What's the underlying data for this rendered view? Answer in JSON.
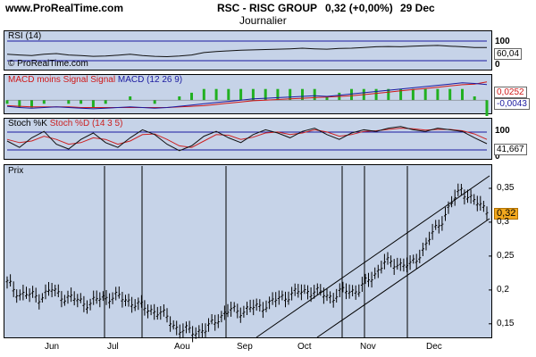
{
  "header": {
    "site": "www.ProRealTime.com",
    "title": "RSC - RISC GROUP",
    "quote": "0,32 (+0,00%)",
    "date": "29 Dec",
    "period": "Journalier"
  },
  "panels": {
    "rsi": {
      "label": "RSI (14)",
      "watermark": "© ProRealTime.com",
      "scale_top": "100",
      "scale_bottom": "0",
      "last_tag": "60,04"
    },
    "macd": {
      "label_a": "MACD moins Signal",
      "label_b": "Signal",
      "label_c": "MACD (12 26 9)",
      "tag_pos": "0,0252",
      "tag_neg": "-0,0043"
    },
    "stoch": {
      "label_a": "Stoch %K",
      "label_b": "Stoch %D (14 3 5)",
      "scale_top": "100",
      "scale_bottom": "0",
      "last_tag": "41,667"
    },
    "price": {
      "label": "Prix",
      "last_tag": "0,32"
    }
  },
  "colors": {
    "panel_bg": "#c6d3e8",
    "macd_red": "#d01818",
    "macd_blue": "#1a1aa0",
    "hist_green": "#21b021",
    "stoch_red": "#cc2222",
    "price_tag": "#f2a81e"
  },
  "chart_data": {
    "type": "line",
    "x_ticks": [
      "Jun",
      "Jul",
      "Aou",
      "Sep",
      "Oct",
      "Nov",
      "Dec"
    ],
    "y_ticks": [
      "0,35",
      "0,3",
      "0,25",
      "0,2",
      "0,15"
    ],
    "ylim": [
      0.13,
      0.375
    ],
    "x_range_days": 150,
    "price_path": [
      [
        0,
        0.21
      ],
      [
        4,
        0.195
      ],
      [
        10,
        0.19
      ],
      [
        14,
        0.2
      ],
      [
        18,
        0.19
      ],
      [
        22,
        0.185
      ],
      [
        26,
        0.18
      ],
      [
        30,
        0.19
      ],
      [
        34,
        0.19
      ],
      [
        38,
        0.185
      ],
      [
        42,
        0.175
      ],
      [
        46,
        0.17
      ],
      [
        50,
        0.16
      ],
      [
        54,
        0.14
      ],
      [
        58,
        0.14
      ],
      [
        62,
        0.14
      ],
      [
        66,
        0.16
      ],
      [
        70,
        0.17
      ],
      [
        74,
        0.17
      ],
      [
        78,
        0.175
      ],
      [
        82,
        0.18
      ],
      [
        86,
        0.19
      ],
      [
        90,
        0.195
      ],
      [
        94,
        0.2
      ],
      [
        98,
        0.195
      ],
      [
        102,
        0.19
      ],
      [
        106,
        0.2
      ],
      [
        110,
        0.2
      ],
      [
        114,
        0.22
      ],
      [
        118,
        0.24
      ],
      [
        122,
        0.24
      ],
      [
        126,
        0.235
      ],
      [
        130,
        0.26
      ],
      [
        134,
        0.29
      ],
      [
        138,
        0.32
      ],
      [
        142,
        0.35
      ],
      [
        146,
        0.33
      ],
      [
        150,
        0.32
      ]
    ],
    "rsi": [
      40,
      38,
      36,
      40,
      42,
      38,
      36,
      34,
      35,
      37,
      40,
      36,
      34,
      33,
      35,
      38,
      45,
      48,
      50,
      52,
      53,
      54,
      55,
      56,
      58,
      56,
      55,
      57,
      58,
      60,
      62,
      63,
      62,
      64,
      65,
      66,
      64,
      62,
      60,
      60
    ],
    "macd": [
      -0.01,
      -0.012,
      -0.013,
      -0.012,
      -0.011,
      -0.012,
      -0.013,
      -0.014,
      -0.013,
      -0.012,
      -0.011,
      -0.012,
      -0.013,
      -0.012,
      -0.01,
      -0.008,
      -0.006,
      -0.004,
      -0.002,
      0.0,
      0.002,
      0.003,
      0.004,
      0.005,
      0.006,
      0.007,
      0.006,
      0.008,
      0.01,
      0.012,
      0.014,
      0.016,
      0.018,
      0.02,
      0.022,
      0.024,
      0.026,
      0.028,
      0.027,
      0.0252
    ],
    "macd_signal": [
      -0.009,
      -0.01,
      -0.011,
      -0.011,
      -0.011,
      -0.011,
      -0.012,
      -0.012,
      -0.012,
      -0.012,
      -0.012,
      -0.012,
      -0.012,
      -0.012,
      -0.011,
      -0.01,
      -0.009,
      -0.007,
      -0.005,
      -0.003,
      -0.001,
      0.0,
      0.001,
      0.002,
      0.003,
      0.004,
      0.005,
      0.006,
      0.007,
      0.009,
      0.011,
      0.013,
      0.015,
      0.017,
      0.019,
      0.021,
      0.023,
      0.025,
      0.026,
      0.0295
    ],
    "stoch_k": [
      50,
      30,
      60,
      80,
      40,
      25,
      55,
      75,
      45,
      30,
      60,
      85,
      70,
      40,
      20,
      35,
      65,
      80,
      60,
      45,
      70,
      85,
      75,
      60,
      80,
      90,
      70,
      55,
      75,
      85,
      80,
      90,
      95,
      85,
      80,
      90,
      85,
      80,
      60,
      41.667
    ],
    "stoch_d": [
      55,
      45,
      50,
      65,
      55,
      40,
      45,
      60,
      55,
      40,
      50,
      70,
      72,
      55,
      35,
      30,
      50,
      70,
      68,
      55,
      62,
      75,
      78,
      70,
      75,
      85,
      78,
      65,
      70,
      80,
      82,
      86,
      90,
      88,
      84,
      86,
      86,
      82,
      72,
      55
    ]
  }
}
